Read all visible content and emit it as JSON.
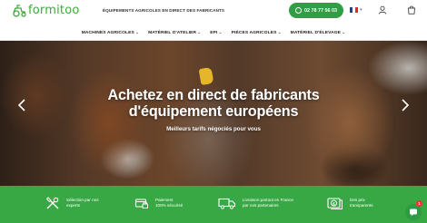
{
  "brand": {
    "name": "formitoo",
    "tagline": "ÉQUIPEMENTS AGRICOLES EN DIRECT DES FABRICANTS",
    "color": "#3fa83b"
  },
  "header": {
    "phone": "02 78 77 56 03",
    "language_caret": "▾"
  },
  "nav": [
    {
      "label": "MACHINES AGRICOLES",
      "chevron": "⌄"
    },
    {
      "label": "MATÉRIEL D'ATELIER",
      "chevron": "⌄"
    },
    {
      "label": "EPI",
      "chevron": "⌄"
    },
    {
      "label": "PIÈCES AGRICOLES",
      "chevron": "⌄"
    },
    {
      "label": "MATÉRIEL D'ÉLEVAGE",
      "chevron": "⌄"
    }
  ],
  "hero": {
    "title_line1": "Achetez en direct de fabricants",
    "title_line2": "d'équipement européens",
    "subtitle": "Meilleurs tarifs négociés pour vous"
  },
  "features": [
    {
      "icon": "tools-icon",
      "text": "Sélection par nos\nexperts"
    },
    {
      "icon": "card-lock-icon",
      "text": "Paiement\n100% sécurisé"
    },
    {
      "icon": "delivery-truck-icon",
      "text": "Livraison partout en France\npar nos partenaires"
    },
    {
      "icon": "price-tag-icon",
      "text": "Des prix\ntransparents"
    }
  ],
  "chat": {
    "badge_count": "1"
  },
  "colors": {
    "accent": "#2f9e44",
    "band": "#38a844"
  }
}
